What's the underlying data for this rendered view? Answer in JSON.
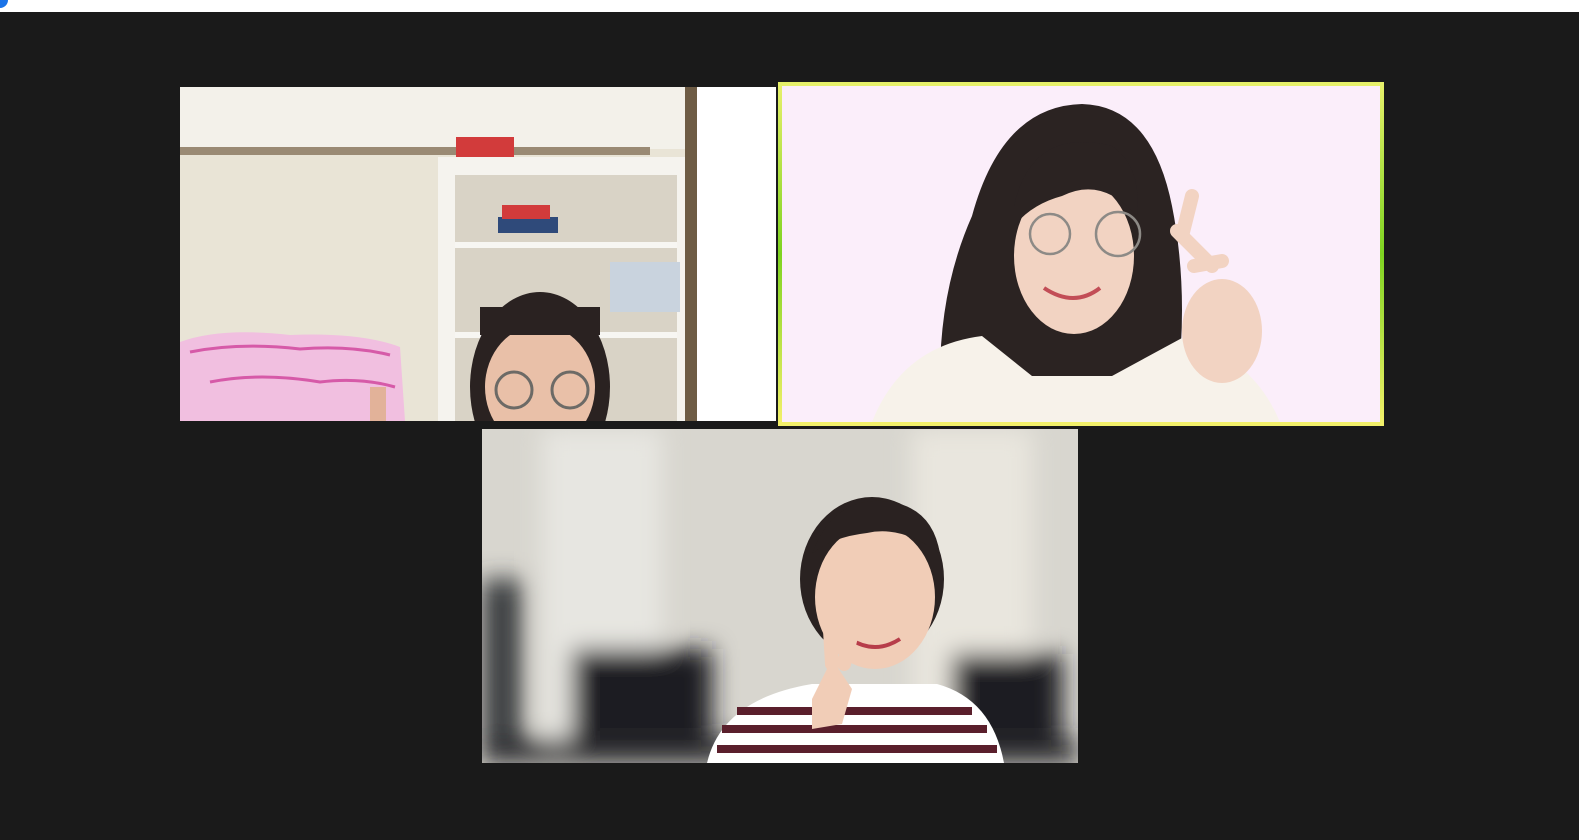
{
  "window": {
    "topbar_accent": "#1a73e8"
  },
  "gallery": {
    "layout": "gallery-view",
    "tiles": [
      {
        "id": "participant-1",
        "display_name": "",
        "is_active_speaker": false,
        "scene": "bedroom-bookshelf-glasses"
      },
      {
        "id": "participant-2",
        "display_name": "",
        "is_active_speaker": true,
        "active_speaker_color": "#c8e84a",
        "scene": "pink-background-peace-sign"
      },
      {
        "id": "participant-3",
        "display_name": "",
        "is_active_speaker": false,
        "scene": "blurred-room-peace-sign"
      }
    ]
  }
}
